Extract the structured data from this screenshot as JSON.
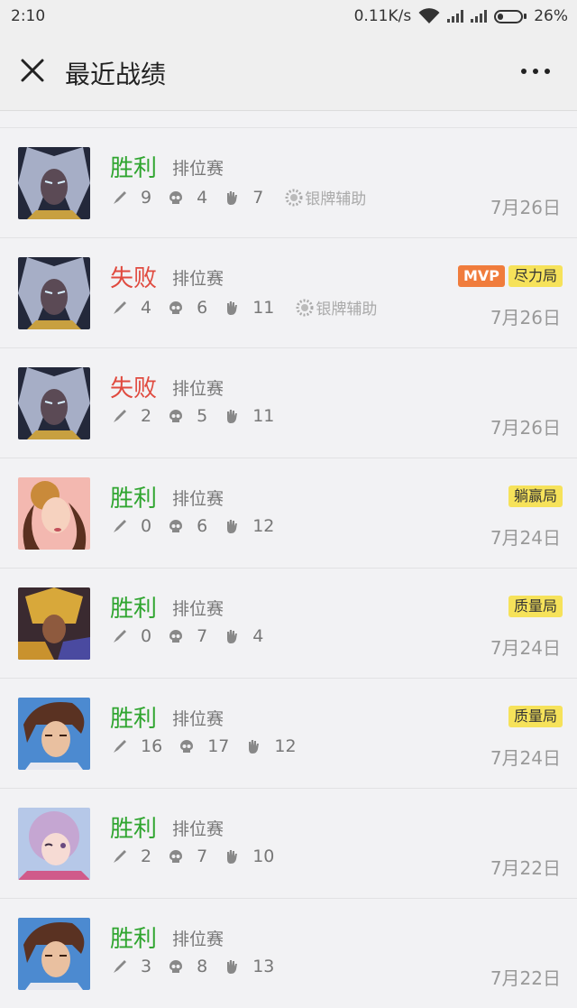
{
  "status_bar": {
    "time": "2:10",
    "speed": "0.11K/s",
    "battery": "26%",
    "battery_level": 0.26
  },
  "nav": {
    "title": "最近战绩"
  },
  "matches": [
    {
      "result": "胜利",
      "outcome": "win",
      "mode": "排位赛",
      "kills": "9",
      "deaths": "4",
      "assists": "7",
      "medal": "银牌辅助",
      "badges": [],
      "date": "7月26日",
      "hero": "hero-silver-hair"
    },
    {
      "result": "失败",
      "outcome": "lose",
      "mode": "排位赛",
      "kills": "4",
      "deaths": "6",
      "assists": "11",
      "medal": "银牌辅助",
      "badges": [
        {
          "text": "MVP",
          "style": "mvp"
        },
        {
          "text": "尽力局",
          "style": "yellow"
        }
      ],
      "date": "7月26日",
      "hero": "hero-silver-hair"
    },
    {
      "result": "失败",
      "outcome": "lose",
      "mode": "排位赛",
      "kills": "2",
      "deaths": "5",
      "assists": "11",
      "medal": "",
      "badges": [],
      "date": "7月26日",
      "hero": "hero-silver-hair"
    },
    {
      "result": "胜利",
      "outcome": "win",
      "mode": "排位赛",
      "kills": "0",
      "deaths": "6",
      "assists": "12",
      "medal": "",
      "badges": [
        {
          "text": "躺赢局",
          "style": "yellow"
        }
      ],
      "date": "7月24日",
      "hero": "hero-pink"
    },
    {
      "result": "胜利",
      "outcome": "win",
      "mode": "排位赛",
      "kills": "0",
      "deaths": "7",
      "assists": "4",
      "medal": "",
      "badges": [
        {
          "text": "质量局",
          "style": "yellow"
        }
      ],
      "date": "7月24日",
      "hero": "hero-gold-armor"
    },
    {
      "result": "胜利",
      "outcome": "win",
      "mode": "排位赛",
      "kills": "16",
      "deaths": "17",
      "assists": "12",
      "medal": "",
      "badges": [
        {
          "text": "质量局",
          "style": "yellow"
        }
      ],
      "date": "7月24日",
      "hero": "hero-brown-hair"
    },
    {
      "result": "胜利",
      "outcome": "win",
      "mode": "排位赛",
      "kills": "2",
      "deaths": "7",
      "assists": "10",
      "medal": "",
      "badges": [],
      "date": "7月22日",
      "hero": "hero-lilac"
    },
    {
      "result": "胜利",
      "outcome": "win",
      "mode": "排位赛",
      "kills": "3",
      "deaths": "8",
      "assists": "13",
      "medal": "",
      "badges": [],
      "date": "7月22日",
      "hero": "hero-brown-hair"
    }
  ],
  "colors": {
    "win": "#2fa52f",
    "lose": "#e04a3f",
    "mvp": "#f07c3c",
    "yellow_badge": "#f6e25a"
  },
  "icons": {
    "kills": "sword-icon",
    "deaths": "skull-icon",
    "assists": "hand-icon",
    "medal": "gear-icon"
  }
}
